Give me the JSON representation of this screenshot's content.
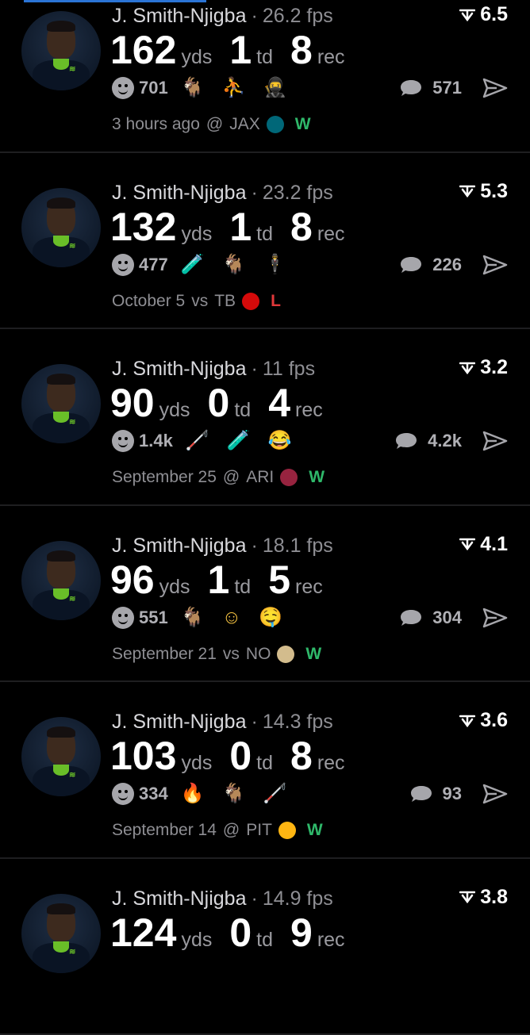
{
  "feed": {
    "cards": [
      {
        "player": "J. Smith-Njigba",
        "fps": "26.2 fps",
        "score": "6.5",
        "yds": "162",
        "yds_unit": "yds",
        "td": "1",
        "td_unit": "td",
        "rec": "8",
        "rec_unit": "rec",
        "reactions": "701",
        "emojis": [
          "goat",
          "player",
          "ninja"
        ],
        "comments": "571",
        "time": "3 hours ago",
        "loc": "@",
        "opp": "JAX",
        "result": "W",
        "result_color": "#2fb86a",
        "opp_color": "#006778"
      },
      {
        "player": "J. Smith-Njigba",
        "fps": "23.2 fps",
        "score": "5.3",
        "yds": "132",
        "yds_unit": "yds",
        "td": "1",
        "td_unit": "td",
        "rec": "8",
        "rec_unit": "rec",
        "reactions": "477",
        "emojis": [
          "test-tube",
          "goat",
          "figure"
        ],
        "comments": "226",
        "time": "October 5",
        "loc": "vs",
        "opp": "TB",
        "result": "L",
        "result_color": "#e0383a",
        "opp_color": "#d50a0a"
      },
      {
        "player": "J. Smith-Njigba",
        "fps": "11 fps",
        "score": "3.2",
        "yds": "90",
        "yds_unit": "yds",
        "td": "0",
        "td_unit": "td",
        "rec": "4",
        "rec_unit": "rec",
        "reactions": "1.4k",
        "emojis": [
          "cane",
          "test-tube",
          "laughing"
        ],
        "comments": "4.2k",
        "time": "September 25",
        "loc": "@",
        "opp": "ARI",
        "result": "W",
        "result_color": "#2fb86a",
        "opp_color": "#97233f"
      },
      {
        "player": "J. Smith-Njigba",
        "fps": "18.1 fps",
        "score": "4.1",
        "yds": "96",
        "yds_unit": "yds",
        "td": "1",
        "td_unit": "td",
        "rec": "5",
        "rec_unit": "rec",
        "reactions": "551",
        "emojis": [
          "goat",
          "smiling",
          "drooling"
        ],
        "comments": "304",
        "time": "September 21",
        "loc": "vs",
        "opp": "NO",
        "result": "W",
        "result_color": "#2fb86a",
        "opp_color": "#d3bc8d"
      },
      {
        "player": "J. Smith-Njigba",
        "fps": "14.3 fps",
        "score": "3.6",
        "yds": "103",
        "yds_unit": "yds",
        "td": "0",
        "td_unit": "td",
        "rec": "8",
        "rec_unit": "rec",
        "reactions": "334",
        "emojis": [
          "fire",
          "goat",
          "cane"
        ],
        "comments": "93",
        "time": "September 14",
        "loc": "@",
        "opp": "PIT",
        "result": "W",
        "result_color": "#2fb86a",
        "opp_color": "#ffb612"
      },
      {
        "player": "J. Smith-Njigba",
        "fps": "14.9 fps",
        "score": "3.8",
        "yds": "124",
        "yds_unit": "yds",
        "td": "0",
        "td_unit": "td",
        "rec": "9",
        "rec_unit": "rec",
        "reactions": "",
        "emojis": [],
        "comments": "",
        "time": "",
        "loc": "",
        "opp": "",
        "result": "",
        "result_color": "#2fb86a",
        "opp_color": "#000"
      }
    ]
  },
  "colors": {
    "background": "#000000",
    "muted": "#8e8e93",
    "win": "#2fb86a",
    "loss": "#e0383a",
    "accent": "#2b74d6"
  }
}
